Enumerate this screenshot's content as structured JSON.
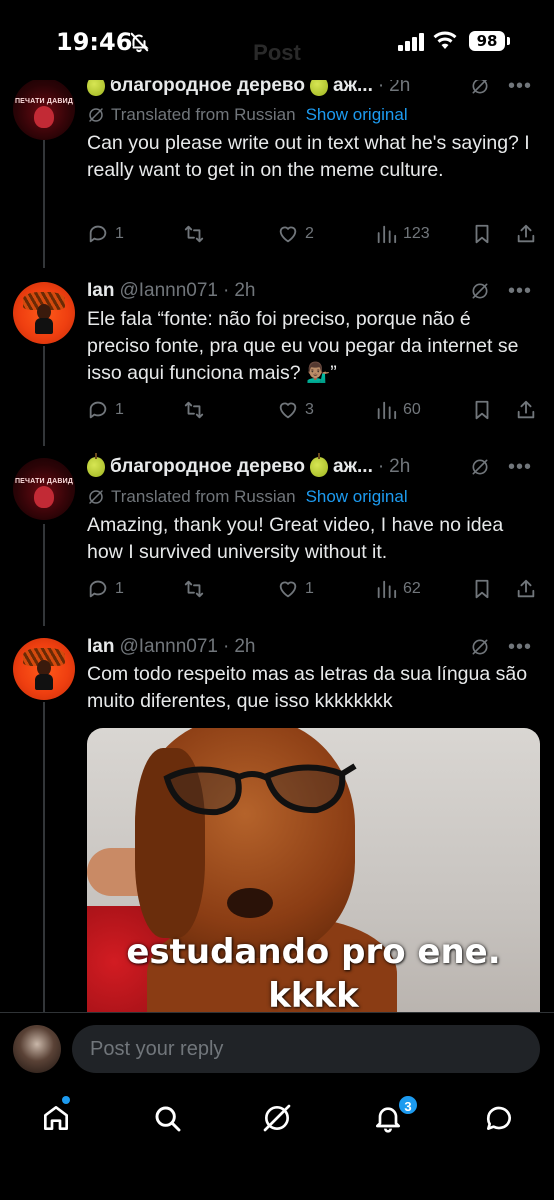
{
  "status_bar": {
    "time": "19:46",
    "battery": "98",
    "ghost_title": "Post"
  },
  "tweets": [
    {
      "name": "благородное дерево",
      "name_suffix": "аж...",
      "time": "2h",
      "translated_label": "Translated from Russian",
      "show_original": "Show original",
      "text": "Can you please write out in text what he's saying? I really want to get in on the meme culture.",
      "replies": "1",
      "reposts": "",
      "likes": "2",
      "views": "123"
    },
    {
      "name": "Ian",
      "handle": "@Iannn071",
      "time": "2h",
      "text": "Ele fala “fonte: não foi preciso, porque não é preciso fonte, pra que eu vou pegar da internet se isso aqui funciona mais? 💁🏽‍♂️”",
      "replies": "1",
      "reposts": "",
      "likes": "3",
      "views": "60"
    },
    {
      "name": "благородное дерево",
      "name_suffix": "аж...",
      "time": "2h",
      "translated_label": "Translated from Russian",
      "show_original": "Show original",
      "text": "Amazing, thank you! Great video, I have no idea how I survived university without it.",
      "replies": "1",
      "reposts": "",
      "likes": "1",
      "views": "62"
    },
    {
      "name": "Ian",
      "handle": "@Iannn071",
      "time": "2h",
      "text": "Com todo respeito mas as letras da sua língua são muito diferentes, que isso kkkkkkkk",
      "media_caption_1": "estudando pro ene.",
      "media_caption_2": "kkkk"
    }
  ],
  "reply_bar": {
    "placeholder": "Post your reply"
  },
  "nav": {
    "notifications_badge": "3",
    "items": [
      "home-icon",
      "search-icon",
      "grok-icon",
      "bell-icon",
      "messages-icon"
    ]
  },
  "colors": {
    "background": "#000000",
    "accent": "#1d9bf0",
    "muted": "#71767b",
    "text": "#e7e9ea"
  }
}
